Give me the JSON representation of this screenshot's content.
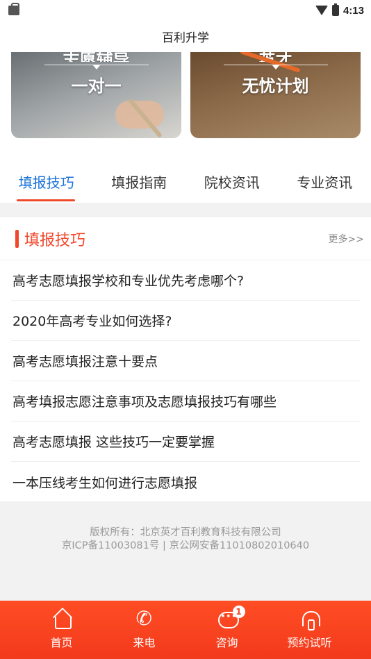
{
  "status_bar": {
    "time": "4:13"
  },
  "header": {
    "title": "百利升学"
  },
  "banners": [
    {
      "top_text": "志愿辅导",
      "main_text": "一对一"
    },
    {
      "top_text": "英才",
      "main_text": "无忧计划"
    }
  ],
  "tabs": [
    {
      "label": "填报技巧"
    },
    {
      "label": "填报指南"
    },
    {
      "label": "院校资讯"
    },
    {
      "label": "专业资讯"
    }
  ],
  "section": {
    "title": "填报技巧",
    "more": "更多>>",
    "articles": [
      "高考志愿填报学校和专业优先考虑哪个?",
      "2020年高考专业如何选择?",
      "高考志愿填报注意十要点",
      "高考填报志愿注意事项及志愿填报技巧有哪些",
      "高考志愿填报 这些技巧一定要掌握",
      "一本压线考生如何进行志愿填报"
    ]
  },
  "footer": {
    "copyright": "版权所有：北京英才百利教育科技有限公司",
    "icp": "京ICP备11003081号 | 京公网安备11010802010640"
  },
  "bottom_nav": [
    {
      "label": "首页",
      "icon": "home-icon"
    },
    {
      "label": "来电",
      "icon": "phone-icon"
    },
    {
      "label": "咨询",
      "icon": "chat-icon",
      "badge": "1"
    },
    {
      "label": "预约试听",
      "icon": "headset-icon"
    }
  ],
  "colors": {
    "accent": "#f0482a",
    "tab_active": "#1a73d9",
    "nav_bg": "#f23a1c"
  }
}
